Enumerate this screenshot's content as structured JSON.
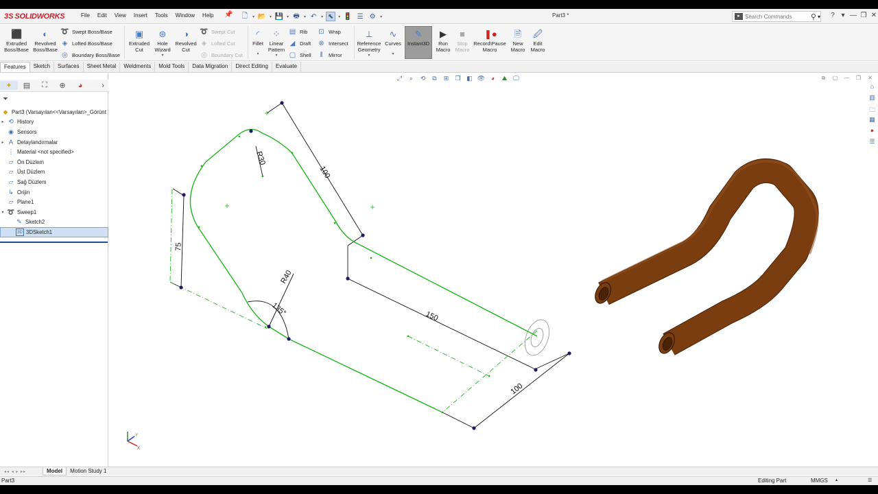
{
  "app": {
    "brand_ds": "3S",
    "brand_name": "SOLIDWORKS",
    "doc_title": "Part3 *"
  },
  "menu": [
    "File",
    "Edit",
    "View",
    "Insert",
    "Tools",
    "Window",
    "Help"
  ],
  "search": {
    "placeholder": "Search Commands",
    "help": "?"
  },
  "ribbon": {
    "extruded_boss": "Extruded Boss/Base",
    "revolved_boss": "Revolved Boss/Base",
    "swept_boss": "Swept Boss/Base",
    "lofted_boss": "Lofted Boss/Base",
    "boundary_boss": "Boundary Boss/Base",
    "extruded_cut": "Extruded Cut",
    "hole_wizard": "Hole Wizard",
    "revolved_cut": "Revolved Cut",
    "swept_cut": "Swept Cut",
    "lofted_cut": "Lofted Cut",
    "boundary_cut": "Boundary Cut",
    "fillet": "Fillet",
    "linear_pattern": "Linear Pattern",
    "rib": "Rib",
    "draft": "Draft",
    "shell": "Shell",
    "wrap": "Wrap",
    "intersect": "Intersect",
    "mirror": "Mirror",
    "reference_geometry": "Reference Geometry",
    "curves": "Curves",
    "instant3d": "Instant3D",
    "run_macro": "Run Macro",
    "stop_macro": "Stop Macro",
    "record_macro": "Record\\Pause Macro",
    "new_macro": "New Macro",
    "edit_macro": "Edit Macro"
  },
  "tabs": [
    "Features",
    "Sketch",
    "Surfaces",
    "Sheet Metal",
    "Weldments",
    "Mold Tools",
    "Data Migration",
    "Direct Editing",
    "Evaluate"
  ],
  "tree": {
    "root": "Part3  (Varsayılan<<Varsayılan>_Görünt",
    "items": [
      {
        "label": "History",
        "icon": "history-icon",
        "expand": "▸",
        "indent": 0
      },
      {
        "label": "Sensors",
        "icon": "sensor-icon",
        "expand": "",
        "indent": 0
      },
      {
        "label": "Detaylandırmalar",
        "icon": "annotations-icon",
        "expand": "▸",
        "indent": 0
      },
      {
        "label": "Material <not specified>",
        "icon": "material-icon",
        "expand": "",
        "indent": 0
      },
      {
        "label": "Ön Düzlem",
        "icon": "plane-icon",
        "expand": "",
        "indent": 0
      },
      {
        "label": "Üst Düzlem",
        "icon": "plane-icon",
        "expand": "",
        "indent": 0
      },
      {
        "label": "Sağ Düzlem",
        "icon": "plane-icon",
        "expand": "",
        "indent": 0
      },
      {
        "label": "Orijin",
        "icon": "origin-icon",
        "expand": "",
        "indent": 0
      },
      {
        "label": "Plane1",
        "icon": "plane-icon",
        "expand": "",
        "indent": 0
      },
      {
        "label": "Sweep1",
        "icon": "sweep-icon",
        "expand": "▾",
        "indent": 0
      },
      {
        "label": "Sketch2",
        "icon": "sketch-icon",
        "expand": "",
        "indent": 1
      },
      {
        "label": "3DSketch1",
        "icon": "3dsketch-icon",
        "expand": "",
        "indent": 1
      }
    ]
  },
  "dimensions": {
    "d100_top": "100",
    "r30": "R30",
    "d75": "75",
    "r40": "R40",
    "a135": "135°",
    "d150": "150",
    "d100_bottom": "100"
  },
  "bottom_tabs": [
    "Model",
    "Motion Study 1"
  ],
  "status": {
    "left": "Part3",
    "mode": "Editing Part",
    "units": "MMGS"
  },
  "colors": {
    "sketch_green": "#22b522",
    "dim_black": "#111111",
    "point_navy": "#1a1a66",
    "pipe_brown": "#7a3d10",
    "pipe_dark": "#4a2206"
  }
}
